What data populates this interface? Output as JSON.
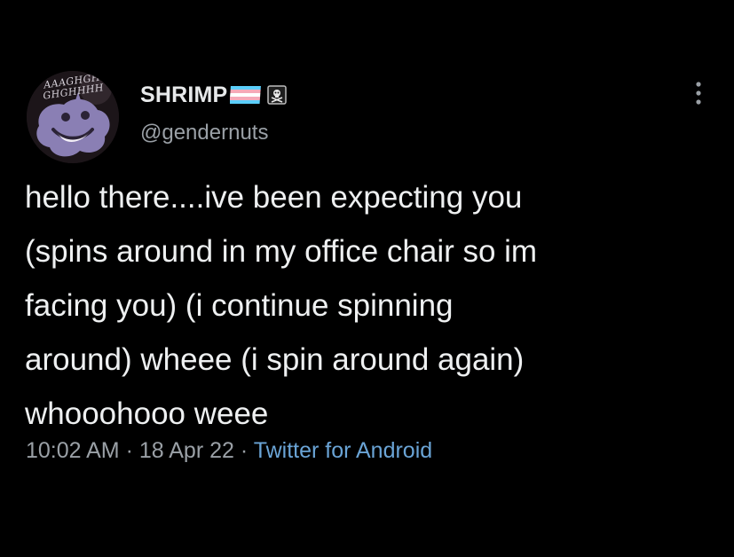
{
  "tweet": {
    "avatar_caption": "AAAGHGH\nGHGHHHH",
    "display_name": "SHRIMP",
    "handle": "@gendernuts",
    "text": "hello there....ive been expecting you\n(spins around in my office chair so im\nfacing you) (i continue spinning\naround) wheee (i spin around again)\nwhooohooo weee",
    "time": "10:02 AM",
    "separator": "·",
    "date": "18 Apr 22",
    "source": "Twitter for Android"
  },
  "icons": {
    "flag": "transgender-flag-icon",
    "pirate": "pirate-flag-icon",
    "more": "more-vertical-icon"
  },
  "colors": {
    "background": "#000000",
    "text": "#e7e9ea",
    "secondary": "#9aa0a6",
    "link": "#6aa4d6",
    "flag_blue": "#5bcefa",
    "flag_pink": "#f5a9b8",
    "flag_white": "#ffffff"
  }
}
